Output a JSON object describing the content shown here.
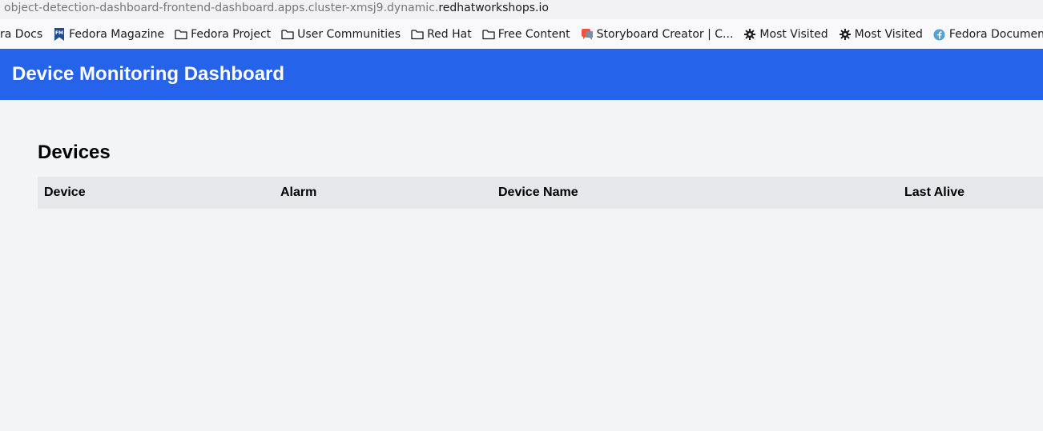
{
  "browser": {
    "url_faded": "object-detection-dashboard-frontend-dashboard.apps.cluster-xmsj9.dynamic.",
    "url_domain": "redhatworkshops.io"
  },
  "bookmarks": [
    {
      "label": "ra Docs",
      "icon": "none"
    },
    {
      "label": "Fedora Magazine",
      "icon": "fedora-magazine-icon"
    },
    {
      "label": "Fedora Project",
      "icon": "folder-icon"
    },
    {
      "label": "User Communities",
      "icon": "folder-icon"
    },
    {
      "label": "Red Hat",
      "icon": "folder-icon"
    },
    {
      "label": "Free Content",
      "icon": "folder-icon"
    },
    {
      "label": "Storyboard Creator | C...",
      "icon": "storyboard-icon"
    },
    {
      "label": "Most Visited",
      "icon": "gear-icon"
    },
    {
      "label": "Most Visited",
      "icon": "gear-icon"
    },
    {
      "label": "Fedora Documentation",
      "icon": "fedora-logo-icon"
    },
    {
      "label": "",
      "icon": "globe-icon"
    }
  ],
  "header": {
    "title": "Device Monitoring Dashboard",
    "background": "#2563eb"
  },
  "devices": {
    "title": "Devices",
    "columns": [
      "Device",
      "Alarm",
      "Device Name",
      "Last Alive"
    ],
    "rows": []
  }
}
